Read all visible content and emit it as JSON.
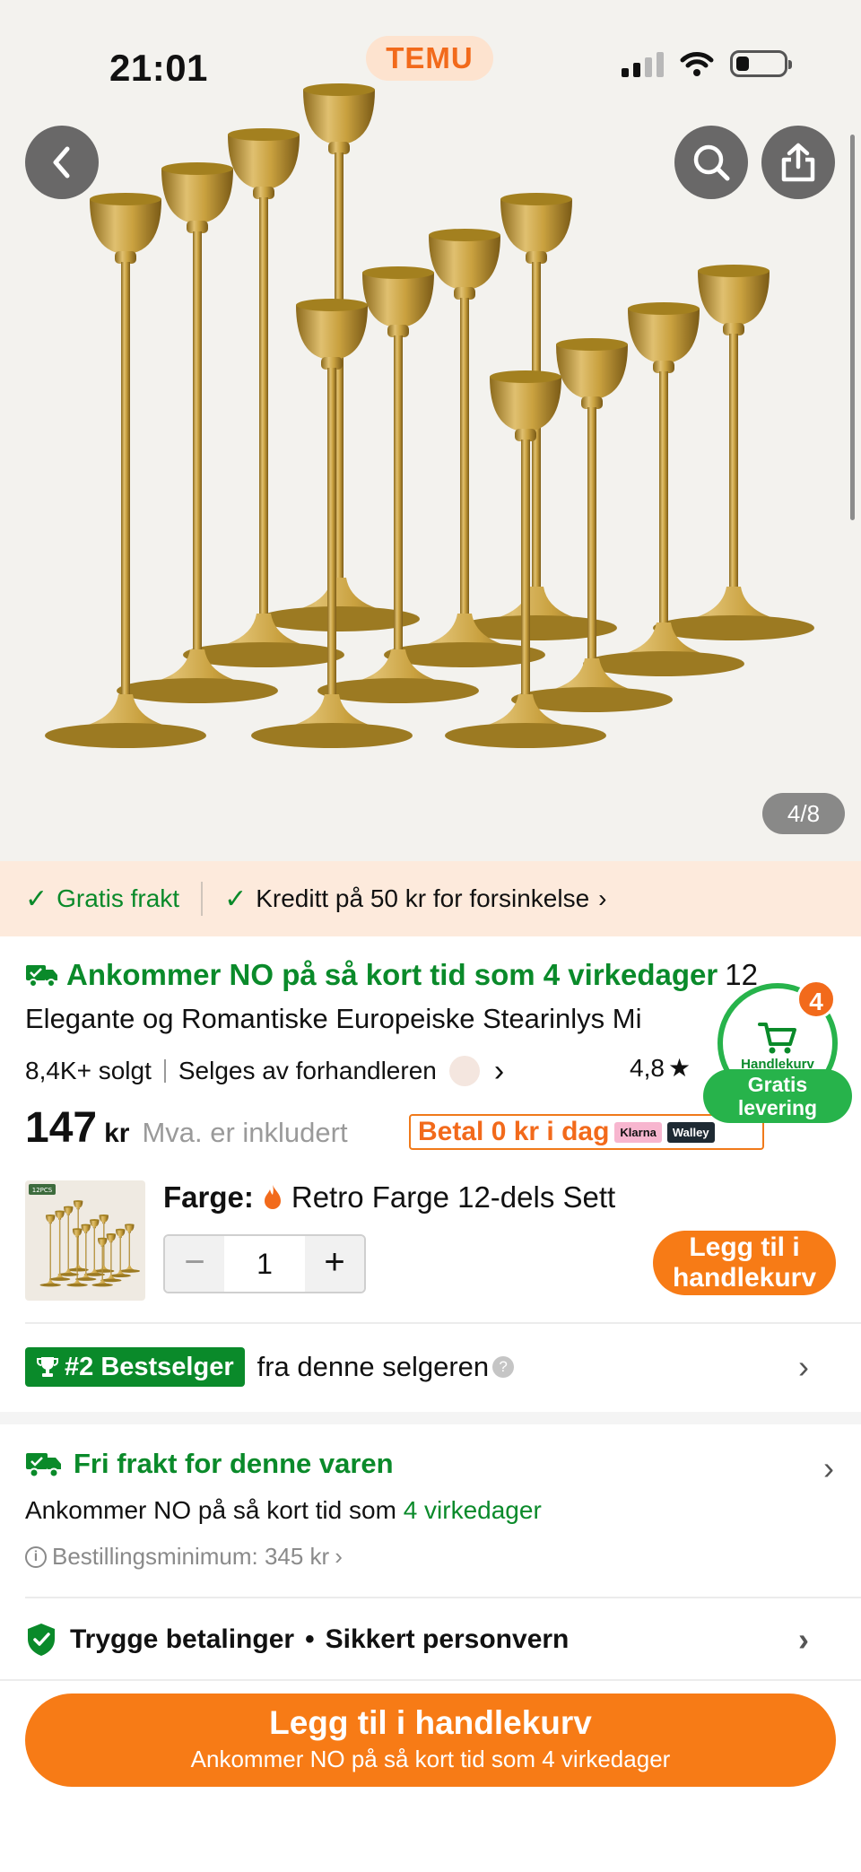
{
  "status_bar": {
    "time": "21:01",
    "brand": "TEMU"
  },
  "gallery": {
    "counter": "4/8"
  },
  "perks": {
    "free_shipping": "Gratis frakt",
    "credit": "Kreditt på 50 kr for forsinkelse"
  },
  "product": {
    "delivery_headline": "Ankommer NO på så kort tid som 4 virkedager",
    "title_start": "12",
    "title_rest": "Elegante og Romantiske Europeiske Stearinlys Mi",
    "sold": "8,4K+ solgt",
    "seller": "Selges av forhandleren",
    "rating": "4,8",
    "price": "147",
    "currency": "kr",
    "vat_note": "Mva. er inkludert",
    "pay_later": "Betal 0 kr i dag",
    "pay_brands": [
      "Klarna",
      "Walley"
    ]
  },
  "floating_cart": {
    "count": "4",
    "label": "Handlekurv",
    "free_delivery_line1": "Gratis",
    "free_delivery_line2": "levering"
  },
  "variant": {
    "label": "Farge:",
    "value": "Retro Farge 12-dels Sett",
    "thumb_badge": "12PCS",
    "quantity": "1",
    "minus": "−",
    "plus": "+",
    "add_line1": "Legg til i",
    "add_line2": "handlekurv"
  },
  "bestseller": {
    "badge": "#2 Bestselger",
    "text": "fra denne selgeren",
    "help": "?"
  },
  "shipping": {
    "title": "Fri frakt for denne varen",
    "sub_prefix": "Ankommer NO på så kort tid som",
    "sub_highlight": "4 virkedager",
    "minimum": "Bestillingsminimum: 345 kr"
  },
  "security": {
    "payments": "Trygge betalinger",
    "privacy": "Sikkert personvern"
  },
  "cta": {
    "main": "Legg til i handlekurv",
    "sub": "Ankommer NO på så kort tid som 4 virkedager"
  },
  "colors": {
    "accent_orange": "#f77b16",
    "green": "#0a8a2a",
    "brass": "#c9a13f"
  }
}
